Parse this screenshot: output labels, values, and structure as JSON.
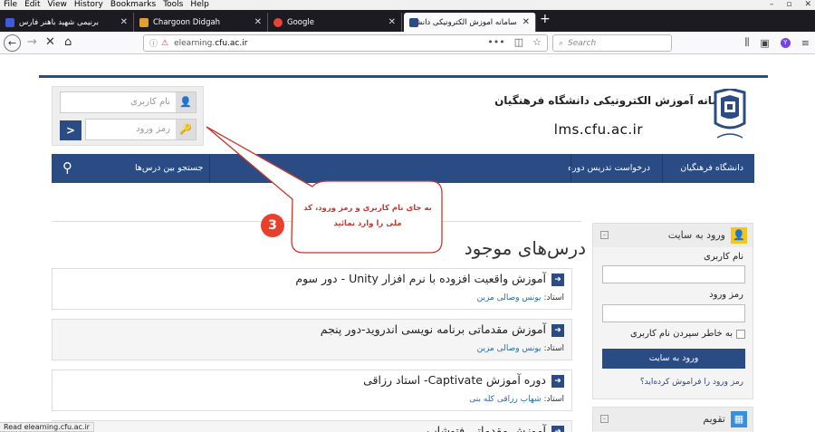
{
  "menu": [
    "File",
    "Edit",
    "View",
    "History",
    "Bookmarks",
    "Tools",
    "Help"
  ],
  "tabs": [
    {
      "title": "برنیمی شهید باهنر فارس",
      "fav": "#3b5bdb"
    },
    {
      "title": "Chargoon Didgah",
      "fav": "#e0a030"
    },
    {
      "title": "Google",
      "fav": "#e94335"
    },
    {
      "title": "سامانه آموزش الکترونیکی دانشگاه ف",
      "fav": "#2b4b85"
    }
  ],
  "url": {
    "prefix": "elearning.",
    "domain": "cfu.ac.ir"
  },
  "search_placeholder": "Search",
  "login": {
    "username_placeholder": "نام کاربری",
    "password_placeholder": "رمز ورود",
    "go": ">"
  },
  "header": {
    "title": "سامانه آموزش الکترونیکی دانشگاه فرهنگیان",
    "domain": "lms.cfu.ac.ir"
  },
  "nav": {
    "university": "دانشگاه فرهنگیان",
    "request": "درخواست تدریس دوره",
    "search": "جستجو بین درس‌ها"
  },
  "callout": {
    "line1": "به جای نام کاربری و رمز ورود، کد",
    "line2": "ملی را وارد نمائید",
    "badge": "3"
  },
  "courses_heading": "درس‌های موجود",
  "courses": [
    {
      "title": "آموزش واقعیت افزوده با نرم افزار Unity  - دور سوم",
      "teacher_label": "استاد:",
      "teacher": "یونس وصالی مزین"
    },
    {
      "title": "آموزش مقدماتی برنامه نویسی اندروید-دور پنجم",
      "teacher_label": "استاد:",
      "teacher": "یونس وصالی مزین"
    },
    {
      "title": "دوره آموزش Captivate-  استاد رزاقی",
      "teacher_label": "استاد:",
      "teacher": "شهاب رزاقی کله بنی"
    },
    {
      "title": "آموزش مقدماتی فتوشاپ"
    }
  ],
  "sidebar": {
    "login_title": "ورود به سایت",
    "username_label": "نام کاربری",
    "password_label": "رمز ورود",
    "remember": "به خاطر سپردن نام کاربری",
    "login_button": "ورود به سایت",
    "forgot": "رمز ورود را فراموش کرده‌اید؟",
    "calendar_title": "تقویم"
  },
  "status": "Read elearning.cfu.ac.ir"
}
